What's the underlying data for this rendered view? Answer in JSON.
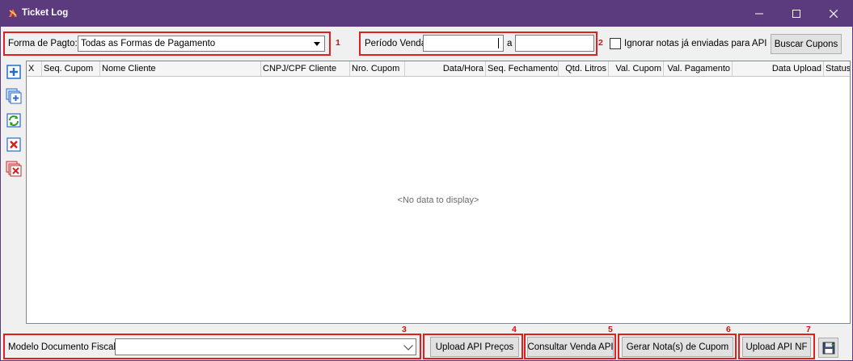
{
  "window": {
    "title": "Ticket Log"
  },
  "filters": {
    "payment_label": "Forma de Pagto:",
    "payment_value": "Todas as Formas de Pagamento",
    "period_label": "Período Venda:",
    "period_from": "",
    "period_separator": "a",
    "period_to": "",
    "ignore_label": "Ignorar notas já enviadas para API",
    "ignore_checked": false,
    "search_button": "Buscar Cupons"
  },
  "markers": [
    "1",
    "2",
    "3",
    "4",
    "5",
    "6",
    "7"
  ],
  "grid": {
    "columns": [
      "X",
      "Seq. Cupom",
      "Nome Cliente",
      "CNPJ/CPF Cliente",
      "Nro. Cupom",
      "Data/Hora",
      "Seq. Fechamento",
      "Qtd. Litros",
      "Val. Cupom",
      "Val. Pagamento",
      "Data Upload",
      "Status"
    ],
    "empty_text": "<No data to display>"
  },
  "footer": {
    "model_label": "Modelo Documento Fiscal:",
    "model_value": "",
    "upload_prices_button": "Upload API Preços",
    "consult_sale_button": "Consultar Venda API",
    "generate_notes_button": "Gerar Nota(s) de Cupom",
    "upload_nf_button": "Upload API NF"
  },
  "colors": {
    "titlebar": "#5c3a7e",
    "highlight": "#e02020"
  }
}
